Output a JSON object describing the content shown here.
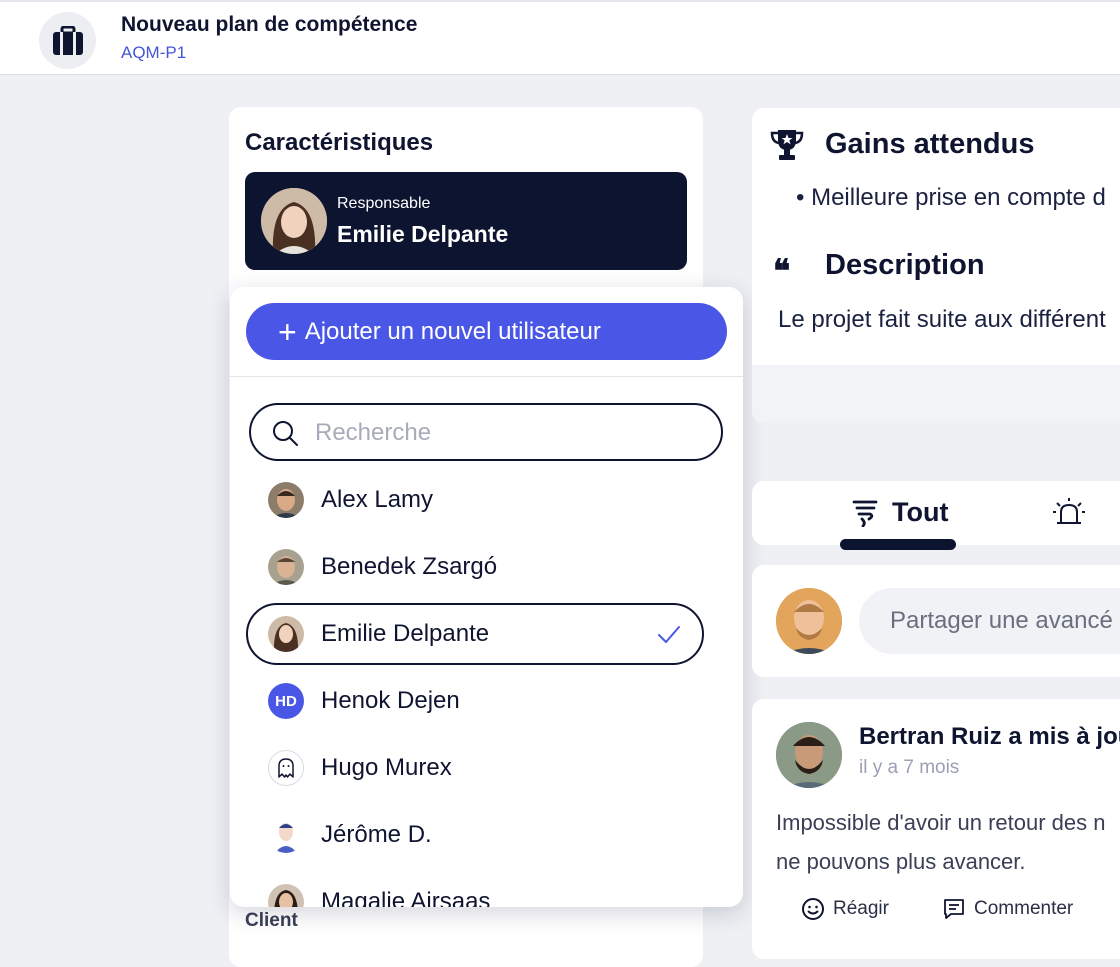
{
  "header": {
    "title": "Nouveau plan de compétence",
    "code": "AQM-P1"
  },
  "characteristics": {
    "heading": "Caractéristiques",
    "responsible_label": "Responsable",
    "responsible_name": "Emilie Delpante",
    "client_label": "Client"
  },
  "dropdown": {
    "add_button": "Ajouter un nouvel utilisateur",
    "search_placeholder": "Recherche",
    "users": [
      {
        "name": "Alex Lamy",
        "avatar": "photo",
        "selected": false
      },
      {
        "name": "Benedek Zsargó",
        "avatar": "photo",
        "selected": false
      },
      {
        "name": "Emilie Delpante",
        "avatar": "photo",
        "selected": true
      },
      {
        "name": "Henok Dejen",
        "avatar": "initials",
        "initials": "HD",
        "selected": false
      },
      {
        "name": "Hugo Murex",
        "avatar": "ghost-icon",
        "selected": false
      },
      {
        "name": "Jérôme D.",
        "avatar": "illustration",
        "selected": false
      },
      {
        "name": "Magalie Airsaas",
        "avatar": "photo",
        "selected": false
      }
    ]
  },
  "project": {
    "gains_title": "Gains attendus",
    "gains_item": "Meilleure prise en compte d",
    "description_title": "Description",
    "description_text": "Le projet fait suite aux différent"
  },
  "tabs": {
    "all_label": "Tout"
  },
  "share": {
    "placeholder": "Partager une avancé"
  },
  "post": {
    "author_line": "Bertran Ruiz a mis à jou",
    "time": "il y a 7 mois",
    "text_line1": "Impossible d'avoir un retour des n",
    "text_line2": "ne pouvons plus avancer.",
    "react_label": "Réagir",
    "comment_label": "Commenter"
  },
  "colors": {
    "accent": "#4a57e6",
    "navy": "#0c1430",
    "background": "#eef0f4"
  }
}
